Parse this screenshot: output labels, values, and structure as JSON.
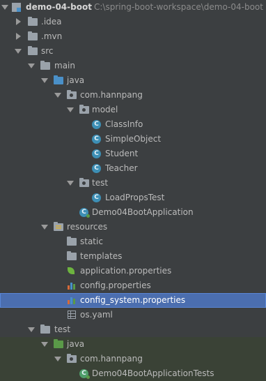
{
  "tree": {
    "root": {
      "name": "demo-04-boot",
      "path": "C:\\spring-boot-workspace\\demo-04-boot"
    },
    "idea": "idea",
    "mvn": "mvn",
    "src": "src",
    "main": "main",
    "main_java": "java",
    "main_pkg": "com.hannpang",
    "model": "model",
    "classinfo": "ClassInfo",
    "simpleobject": "SimpleObject",
    "student": "Student",
    "teacher": "Teacher",
    "pkg_test": "test",
    "loadpropstest": "LoadPropsTest",
    "app_class": "Demo04BootApplication",
    "resources": "resources",
    "static": "static",
    "templates": "templates",
    "application_properties": "application.properties",
    "config_properties": "config.properties",
    "config_system_properties": "config_system.properties",
    "os_yaml": "os.yaml",
    "test": "test",
    "test_java": "java",
    "test_pkg": "com.hannpang",
    "app_tests": "Demo04BootApplicationTests"
  },
  "icons": {
    "class_glyph": "C"
  },
  "colors": {
    "background": "#3c3f41",
    "selection": "#4b6eaf",
    "source_folder": "#4a90c8",
    "test_folder": "#5a9a48"
  }
}
